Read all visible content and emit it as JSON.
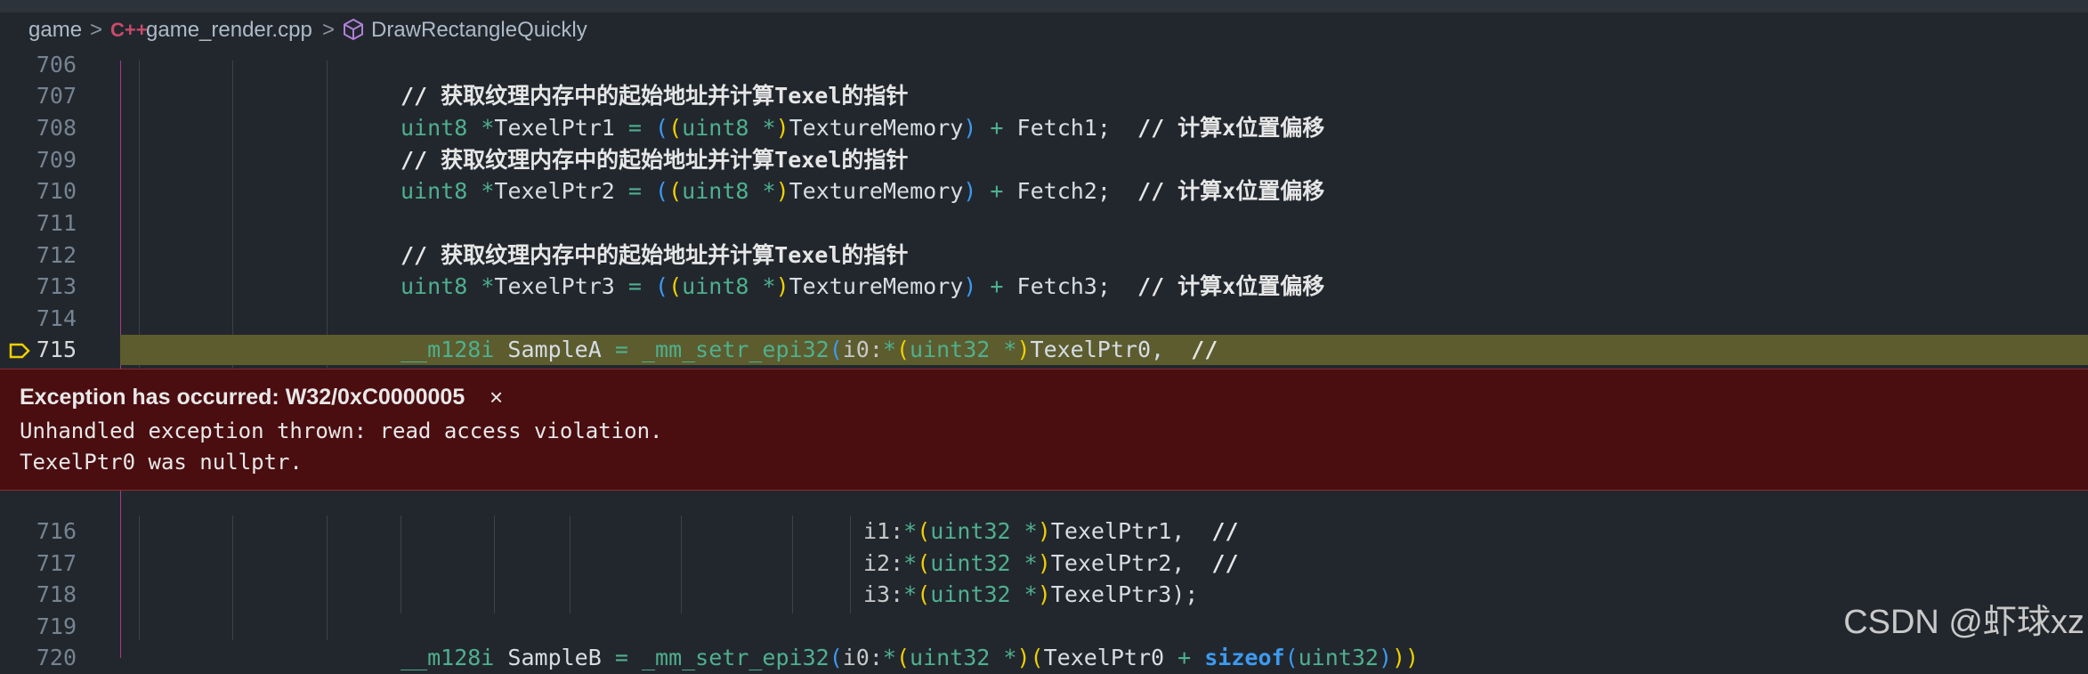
{
  "breadcrumb": {
    "folder": "game",
    "file": "game_render.cpp",
    "symbol": "DrawRectangleQuickly",
    "file_icon": "C++",
    "separator": ">"
  },
  "lines": [
    {
      "num": "706"
    },
    {
      "num": "707",
      "comment": "// 获取纹理内存中的起始地址并计算Texel的指针"
    },
    {
      "num": "708",
      "type": "uint8",
      "op": "*",
      "var": "TexelPtr1",
      "eq": "=",
      "cast_type": "uint8",
      "cast_star": "*",
      "src": "TextureMemory",
      "plus": "+",
      "fetch": "Fetch1;",
      "comment": "// 计算x位置偏移"
    },
    {
      "num": "709",
      "comment": "// 获取纹理内存中的起始地址并计算Texel的指针"
    },
    {
      "num": "710",
      "type": "uint8",
      "op": "*",
      "var": "TexelPtr2",
      "eq": "=",
      "cast_type": "uint8",
      "cast_star": "*",
      "src": "TextureMemory",
      "plus": "+",
      "fetch": "Fetch2;",
      "comment": "// 计算x位置偏移"
    },
    {
      "num": "711"
    },
    {
      "num": "712",
      "comment": "// 获取纹理内存中的起始地址并计算Texel的指针"
    },
    {
      "num": "713",
      "type": "uint8",
      "op": "*",
      "var": "TexelPtr3",
      "eq": "=",
      "cast_type": "uint8",
      "cast_star": "*",
      "src": "TextureMemory",
      "plus": "+",
      "fetch": "Fetch3;",
      "comment": "// 计算x位置偏移"
    },
    {
      "num": "714"
    },
    {
      "num": "715",
      "type": "__m128i",
      "var": "SampleA",
      "eq": "=",
      "fn": "_mm_setr_epi32",
      "inlay": "i0:",
      "deref": "*",
      "cast_type": "uint32",
      "cast_star": "*",
      "arg": "TexelPtr0,",
      "comment": "//"
    }
  ],
  "after_lines": [
    {
      "num": "716",
      "inlay": "i1:",
      "deref": "*",
      "cast_type": "uint32",
      "cast_star": "*",
      "arg": "TexelPtr1,",
      "comment": "//"
    },
    {
      "num": "717",
      "inlay": "i2:",
      "deref": "*",
      "cast_type": "uint32",
      "cast_star": "*",
      "arg": "TexelPtr2,",
      "comment": "//"
    },
    {
      "num": "718",
      "inlay": "i3:",
      "deref": "*",
      "cast_type": "uint32",
      "cast_star": "*",
      "arg": "TexelPtr3);"
    },
    {
      "num": "719"
    },
    {
      "num": "720",
      "type": "__m128i",
      "var": "SampleB",
      "eq": "=",
      "fn": "_mm_setr_epi32",
      "inlay": "i0:",
      "deref": "*",
      "cast_type": "uint32",
      "cast_star": "*",
      "arg": "TexelPtr0",
      "plus": "+",
      "sizeof": "sizeof",
      "sizeof_arg": "uint32",
      "tail": "))"
    }
  ],
  "exception": {
    "title": "Exception has occurred: W32/0xC0000005",
    "close": "×",
    "line1": "Unhandled exception thrown: read access violation.",
    "line2": "TexelPtr0 was nullptr."
  },
  "watermark": "CSDN @虾球xz",
  "colors": {
    "background": "#22272e",
    "current_line": "#5c5c2e",
    "exception_bg": "#4a0d10",
    "keyword": "#4fb08e",
    "paren": "#3c9bf0",
    "paren2": "#f0d000"
  }
}
